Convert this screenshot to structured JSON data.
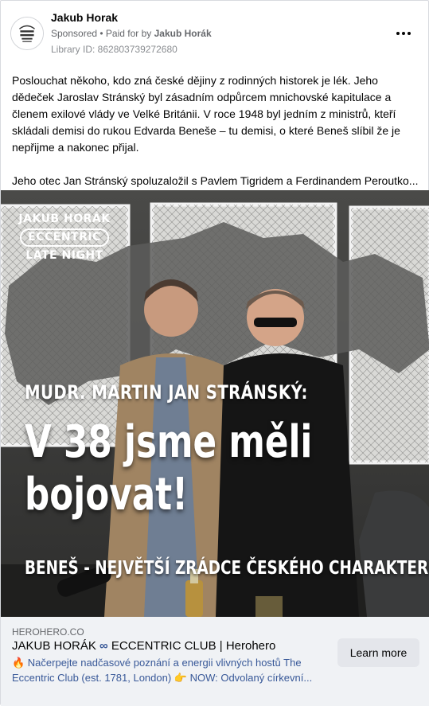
{
  "header": {
    "page_name": "Jakub Horak",
    "sponsored": "Sponsored",
    "paid_for_prefix": " • Paid for by ",
    "paid_for_name": "Jakub Horák",
    "library_id": "Library ID: 862803739272680"
  },
  "body": {
    "paragraph_1": "Poslouchat někoho, kdo zná české dějiny z rodinných historek je lék. Jeho dědeček Jaroslav Stránský byl zásadním odpůrcem mnichovské kapitulace a členem exilové vlády ve Velké Británii. V roce 1948 byl jedním z ministrů, kteří skládali demisi do rukou Edvarda Beneše – tu demisi, o které Beneš slíbil že je nepřijme a nakonec přijal.",
    "paragraph_2": "Jeho otec Jan Stránský spoluzaložil s Pavlem Tigridem a Ferdinandem Peroutko..."
  },
  "media": {
    "logo_line_1": "JAKUB HORÁK",
    "logo_line_2": "ECCENTRIC",
    "logo_line_3": "LATE NIGHT",
    "overline": "MUDR. MARTIN JAN STRÁNSKÝ:",
    "headline": "V 38 jsme měli\nbojovat!",
    "subline": "BENEŠ - NEJVĚTŠÍ ZRÁDCE ČESKÉHO CHARAKTERU",
    "avatar_logo_text": "JAKUB HORÁK LATE NIGHT"
  },
  "link": {
    "domain": "HEROHERO.CO",
    "title_part_1": "JAKUB HORÁK ",
    "title_symbol": "∞",
    "title_part_2": " ECCENTRIC CLUB | Herohero",
    "description": "🔥 Načerpejte nadčasové poznání a energii vlivných hostů The Eccentric Club (est. 1781, London) 👉 NOW: Odvolaný církevní...",
    "cta_label": "Learn more"
  },
  "colors": {
    "text_primary": "#050505",
    "text_secondary": "#65676b",
    "link_blue": "#385898",
    "footer_bg": "#f0f2f5",
    "button_bg": "#e4e6eb"
  }
}
